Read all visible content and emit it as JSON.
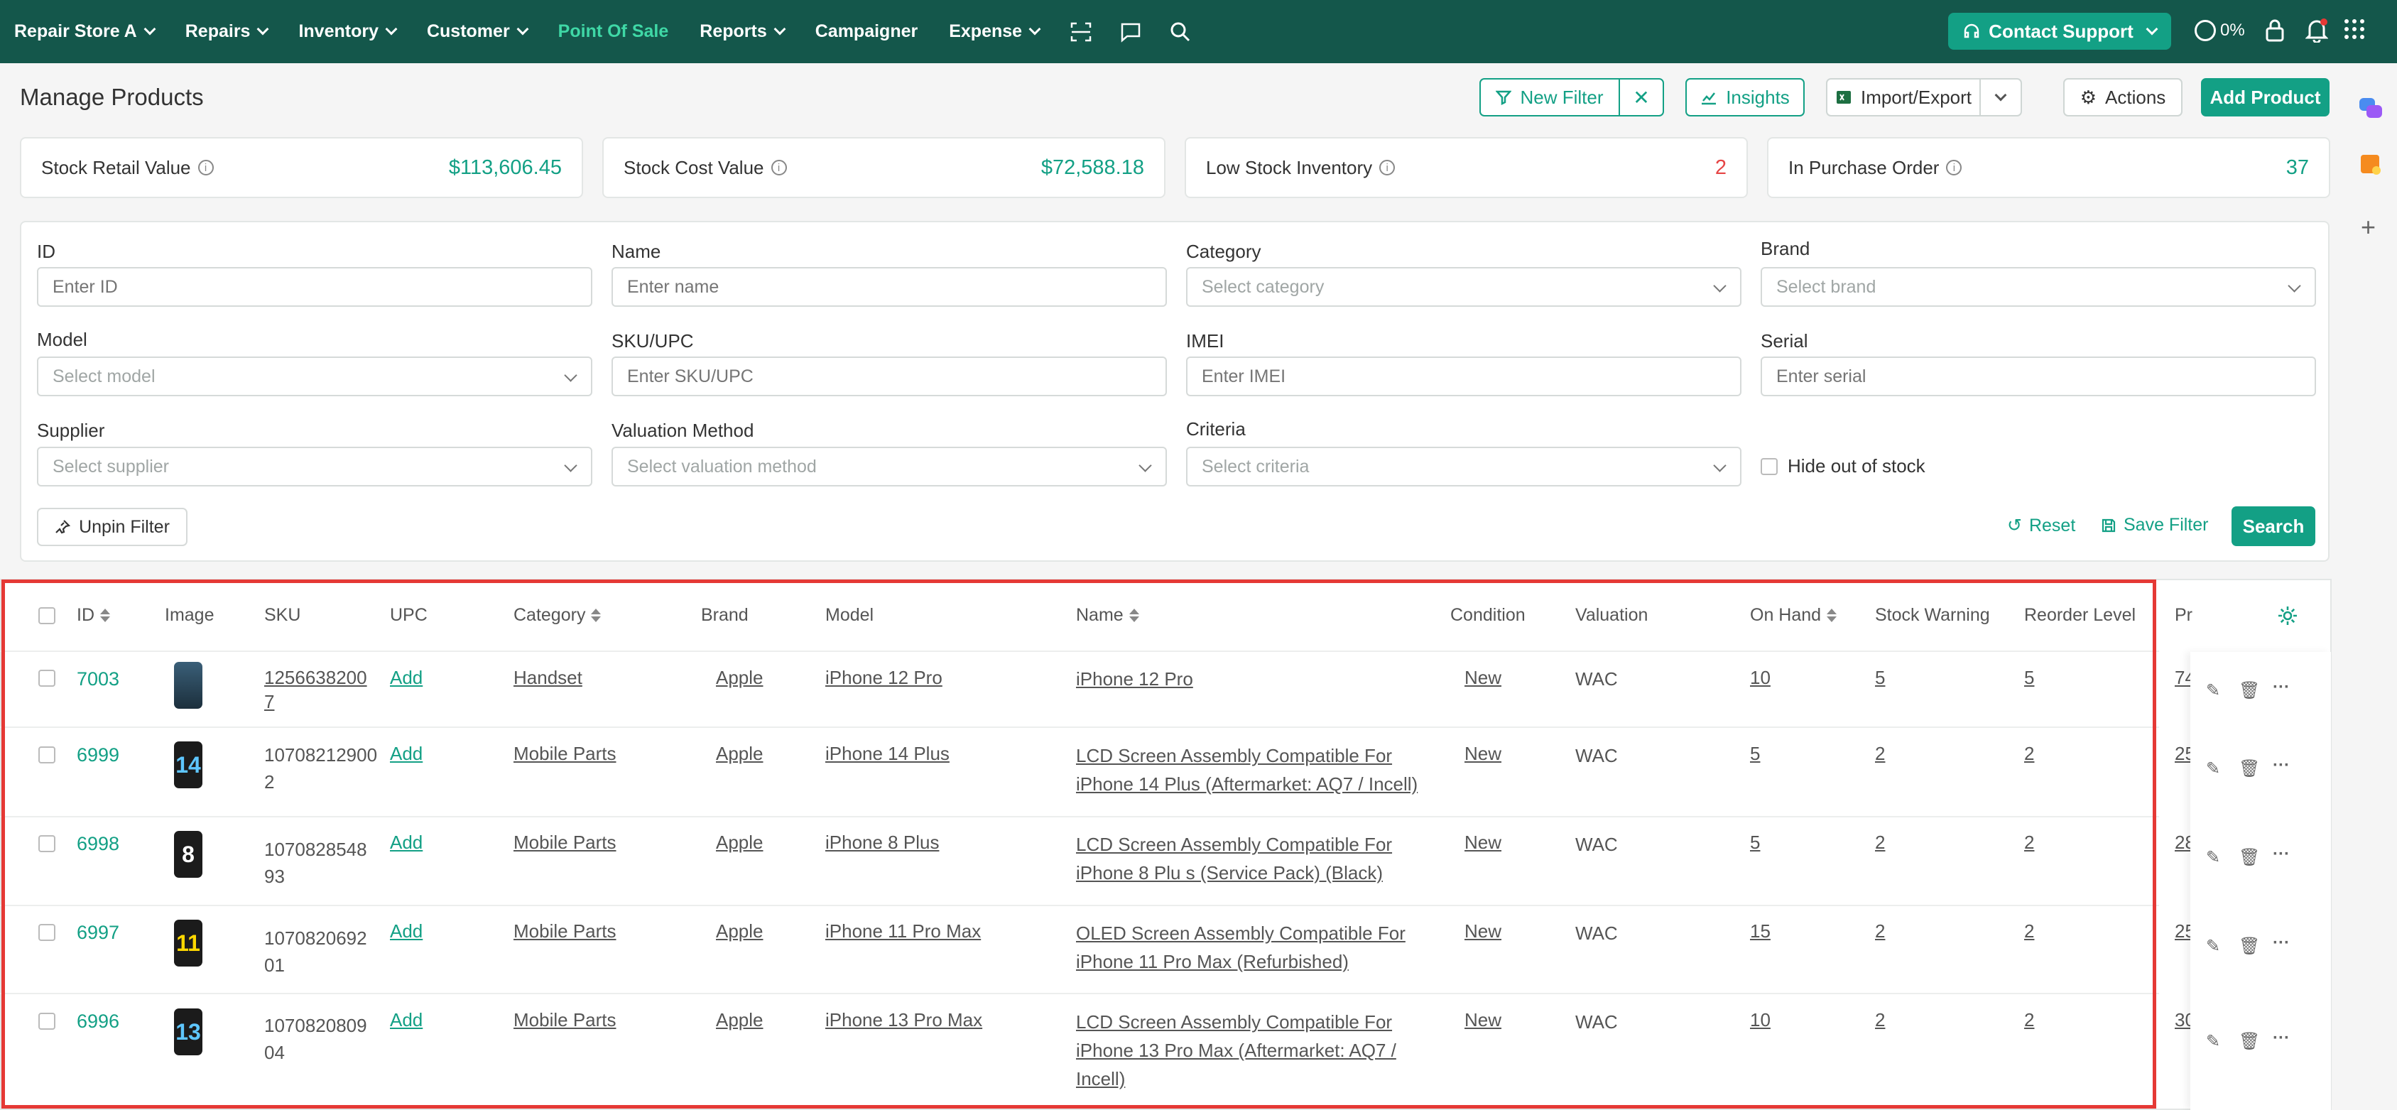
{
  "nav": {
    "store": "Repair Store A",
    "items": [
      "Repairs",
      "Inventory",
      "Customer",
      "Point Of Sale",
      "Reports",
      "Campaigner",
      "Expense"
    ],
    "active": "Point Of Sale",
    "support": "Contact Support",
    "progress": "0%"
  },
  "header": {
    "title": "Manage Products",
    "new_filter": "New Filter",
    "insights": "Insights",
    "import_export": "Import/Export",
    "actions": "Actions",
    "add_product": "Add Product"
  },
  "stats": [
    {
      "label": "Stock Retail Value",
      "value": "$113,606.45"
    },
    {
      "label": "Stock Cost Value",
      "value": "$72,588.18"
    },
    {
      "label": "Low Stock Inventory",
      "value": "2"
    },
    {
      "label": "In Purchase Order",
      "value": "37"
    }
  ],
  "filters": {
    "id": {
      "label": "ID",
      "placeholder": "Enter ID"
    },
    "name": {
      "label": "Name",
      "placeholder": "Enter name"
    },
    "category": {
      "label": "Category",
      "placeholder": "Select category"
    },
    "brand": {
      "label": "Brand",
      "placeholder": "Select brand"
    },
    "model": {
      "label": "Model",
      "placeholder": "Select model"
    },
    "sku": {
      "label": "SKU/UPC",
      "placeholder": "Enter SKU/UPC"
    },
    "imei": {
      "label": "IMEI",
      "placeholder": "Enter IMEI"
    },
    "serial": {
      "label": "Serial",
      "placeholder": "Enter serial"
    },
    "supplier": {
      "label": "Supplier",
      "placeholder": "Select supplier"
    },
    "valuation": {
      "label": "Valuation Method",
      "placeholder": "Select valuation method"
    },
    "criteria": {
      "label": "Criteria",
      "placeholder": "Select criteria"
    },
    "hide_oos": "Hide out of stock",
    "unpin": "Unpin Filter",
    "reset": "Reset",
    "save_filter": "Save Filter",
    "search": "Search"
  },
  "table": {
    "headers": {
      "id": "ID",
      "image": "Image",
      "sku": "SKU",
      "upc": "UPC",
      "category": "Category",
      "brand": "Brand",
      "model": "Model",
      "name": "Name",
      "condition": "Condition",
      "valuation": "Valuation",
      "on_hand": "On Hand",
      "stock_warning": "Stock Warning",
      "reorder": "Reorder Level",
      "price": "Pr"
    },
    "rows": [
      {
        "id": "7003",
        "thumb": "",
        "sku1": "1256638200",
        "sku2": "7",
        "upc": "Add",
        "category": "Handset",
        "brand": "Apple",
        "model": "iPhone 12 Pro",
        "name1": "iPhone 12 Pro",
        "name2": "",
        "name3": "",
        "condition": "New",
        "valuation": "WAC",
        "on_hand": "10",
        "stock_warning": "5",
        "reorder": "5",
        "price": "74"
      },
      {
        "id": "6999",
        "thumb": "14",
        "sku1": "10708212900",
        "sku2": "2",
        "upc": "Add",
        "category": "Mobile Parts",
        "brand": "Apple",
        "model": "iPhone 14 Plus",
        "name1": "LCD Screen Assembly Compatible For",
        "name2": "iPhone 14 Plus (Aftermarket: AQ7 / Incell)",
        "name3": "",
        "condition": "New",
        "valuation": "WAC",
        "on_hand": "5",
        "stock_warning": "2",
        "reorder": "2",
        "price": "25"
      },
      {
        "id": "6998",
        "thumb": "8",
        "sku1": "1070828548",
        "sku2": "93",
        "upc": "Add",
        "category": "Mobile Parts",
        "brand": "Apple",
        "model": "iPhone 8 Plus",
        "name1": "LCD Screen Assembly Compatible For",
        "name2": "iPhone 8 Plu s (Service Pack) (Black)",
        "name3": "",
        "condition": "New",
        "valuation": "WAC",
        "on_hand": "5",
        "stock_warning": "2",
        "reorder": "2",
        "price": "28"
      },
      {
        "id": "6997",
        "thumb": "11",
        "sku1": "1070820692",
        "sku2": "01",
        "upc": "Add",
        "category": "Mobile Parts",
        "brand": "Apple",
        "model": "iPhone 11 Pro Max",
        "name1": "OLED Screen Assembly Compatible For",
        "name2": "iPhone 11 Pro Max (Refurbished)",
        "name3": "",
        "condition": "New",
        "valuation": "WAC",
        "on_hand": "15",
        "stock_warning": "2",
        "reorder": "2",
        "price": "25"
      },
      {
        "id": "6996",
        "thumb": "13",
        "sku1": "1070820809",
        "sku2": "04",
        "upc": "Add",
        "category": "Mobile Parts",
        "brand": "Apple",
        "model": "iPhone 13 Pro Max",
        "name1": "LCD Screen Assembly Compatible For",
        "name2": "iPhone 13 Pro Max (Aftermarket: AQ7 /",
        "name3": "Incell)",
        "condition": "New",
        "valuation": "WAC",
        "on_hand": "10",
        "stock_warning": "2",
        "reorder": "2",
        "price": "30"
      }
    ]
  },
  "colors": {
    "brand": "#14574b",
    "accent": "#13a085",
    "alert": "#e64545",
    "highlight": "#e53935"
  }
}
